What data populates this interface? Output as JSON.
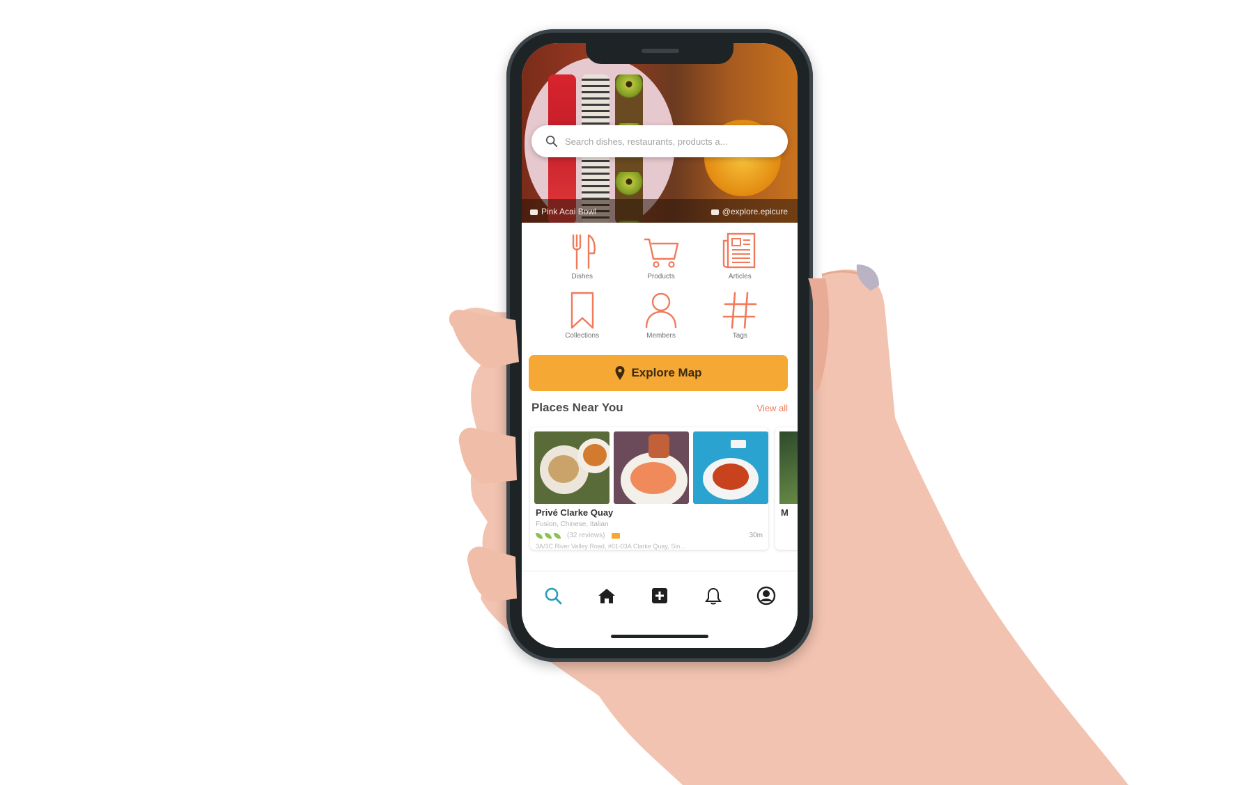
{
  "hero": {
    "search_placeholder": "Search dishes, restaurants, products a...",
    "caption_left": "Pink Acai Bowl",
    "caption_right": "@explore.epicure"
  },
  "categories": [
    {
      "label": "Dishes",
      "icon": "fork-knife-icon"
    },
    {
      "label": "Products",
      "icon": "shopping-cart-icon"
    },
    {
      "label": "Articles",
      "icon": "newspaper-icon"
    },
    {
      "label": "Collections",
      "icon": "bookmark-icon"
    },
    {
      "label": "Members",
      "icon": "person-icon"
    },
    {
      "label": "Tags",
      "icon": "hashtag-icon"
    }
  ],
  "explore_button": {
    "label": "Explore Map",
    "icon": "map-pin-icon"
  },
  "places": {
    "title": "Places Near You",
    "view_all": "View all",
    "cards": [
      {
        "name": "Privé Clarke Quay",
        "cuisine": "Fusion, Chinese, Italian",
        "reviews": "(32 reviews)",
        "distance": "30m",
        "address": "3A/3C River Valley Road, #01-03A Clarke Quay, Sin..."
      },
      {
        "name": "M"
      }
    ]
  },
  "bottom_nav": [
    {
      "name": "search",
      "icon": "search-icon",
      "active": true
    },
    {
      "name": "home",
      "icon": "home-icon",
      "active": false
    },
    {
      "name": "add",
      "icon": "plus-square-icon",
      "active": false
    },
    {
      "name": "notifications",
      "icon": "bell-icon",
      "active": false
    },
    {
      "name": "profile",
      "icon": "user-circle-icon",
      "active": false
    }
  ],
  "colors": {
    "accent_orange": "#f5a833",
    "icon_coral": "#f07a5a",
    "active_teal": "#2a9db8",
    "phone_frame": "#1e2326"
  }
}
